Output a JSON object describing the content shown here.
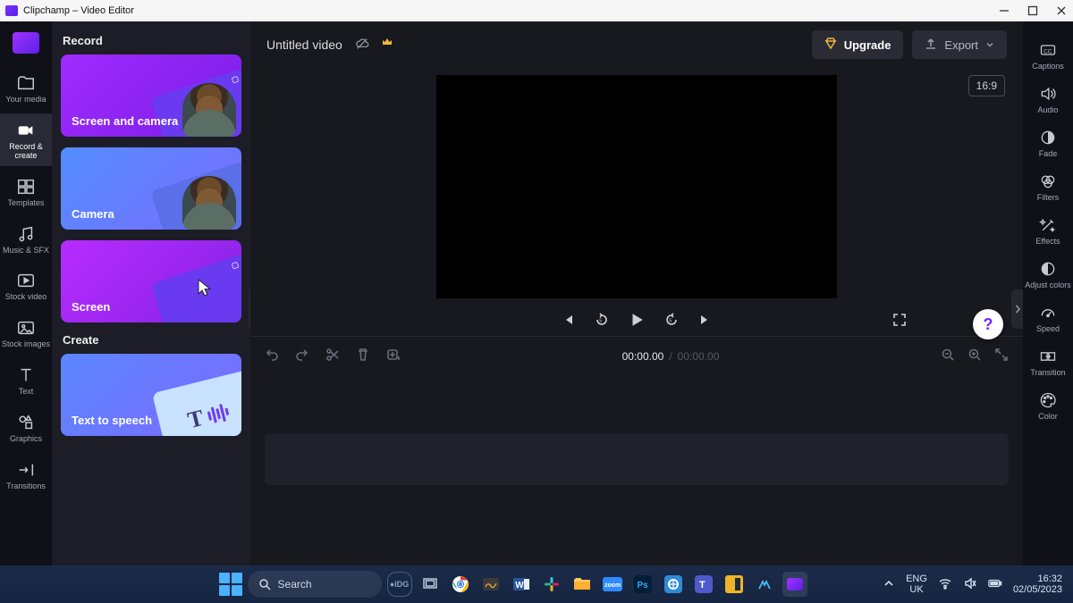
{
  "window": {
    "title": "Clipchamp – Video Editor"
  },
  "rail": {
    "items": [
      {
        "label": "Your media"
      },
      {
        "label": "Record & create"
      },
      {
        "label": "Templates"
      },
      {
        "label": "Music & SFX"
      },
      {
        "label": "Stock video"
      },
      {
        "label": "Stock images"
      },
      {
        "label": "Text"
      },
      {
        "label": "Graphics"
      },
      {
        "label": "Transitions"
      }
    ]
  },
  "panel": {
    "record_header": "Record",
    "create_header": "Create",
    "cards": {
      "screen_camera": "Screen and camera",
      "camera": "Camera",
      "screen": "Screen",
      "tts": "Text to speech"
    }
  },
  "topbar": {
    "project_title": "Untitled video",
    "upgrade_label": "Upgrade",
    "export_label": "Export"
  },
  "preview": {
    "aspect_label": "16:9"
  },
  "timeline": {
    "current_time": "00:00.00",
    "separator": "/",
    "total_time": "00:00.00"
  },
  "proprail": {
    "items": [
      {
        "label": "Captions"
      },
      {
        "label": "Audio"
      },
      {
        "label": "Fade"
      },
      {
        "label": "Filters"
      },
      {
        "label": "Effects"
      },
      {
        "label": "Adjust colors"
      },
      {
        "label": "Speed"
      },
      {
        "label": "Transition"
      },
      {
        "label": "Color"
      }
    ]
  },
  "taskbar": {
    "search_placeholder": "Search",
    "lang_top": "ENG",
    "lang_bottom": "UK",
    "time": "16:32",
    "date": "02/05/2023"
  },
  "help_fab": "?"
}
